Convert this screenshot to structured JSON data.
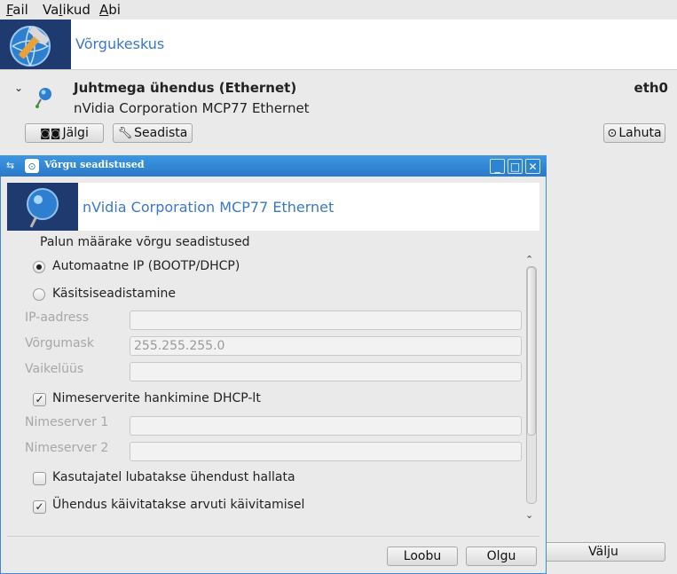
{
  "menubar": {
    "items": [
      {
        "accel": "F",
        "rest": "ail"
      },
      {
        "accel": "",
        "pre": "Va",
        "accel2": "l",
        "rest": "ikud"
      },
      {
        "accel": "A",
        "rest": "bi"
      }
    ]
  },
  "app": {
    "title": "Võrgukeskus"
  },
  "connection": {
    "title": "Juhtmega ühendus (Ethernet)",
    "description": "nVidia Corporation MCP77 Ethernet",
    "interface": "eth0",
    "buttons": {
      "monitor": "Jälgi",
      "configure": "Seadista",
      "disconnect": "Lahuta"
    }
  },
  "main_quit": "Välju",
  "dialog": {
    "title": "Võrgu seadistused",
    "header_title": "nVidia Corporation MCP77 Ethernet",
    "prompt": "Palun määrake võrgu seadistused",
    "radio_auto": "Automaatne IP (BOOTP/DHCP)",
    "radio_manual": "Käsitsiseadistamine",
    "fields": {
      "ip_label": "IP-aadress",
      "ip_value": "",
      "netmask_label": "Võrgumask",
      "netmask_value": "255.255.255.0",
      "gateway_label": "Vaikelüüs",
      "gateway_value": "",
      "ns1_label": "Nimeserver 1",
      "ns1_value": "",
      "ns2_label": "Nimeserver 2",
      "ns2_value": ""
    },
    "check_dhcp_dns": "Nimeserverite hankimine DHCP-lt",
    "check_users_manage": "Kasutajatel lubatakse ühendust hallata",
    "check_start_boot": "Ühendus käivitatakse arvuti käivitamisel",
    "buttons": {
      "cancel": "Loobu",
      "ok": "Olgu"
    }
  },
  "colors": {
    "accent": "#3a78c8",
    "titlebar": "#2a79c8"
  }
}
